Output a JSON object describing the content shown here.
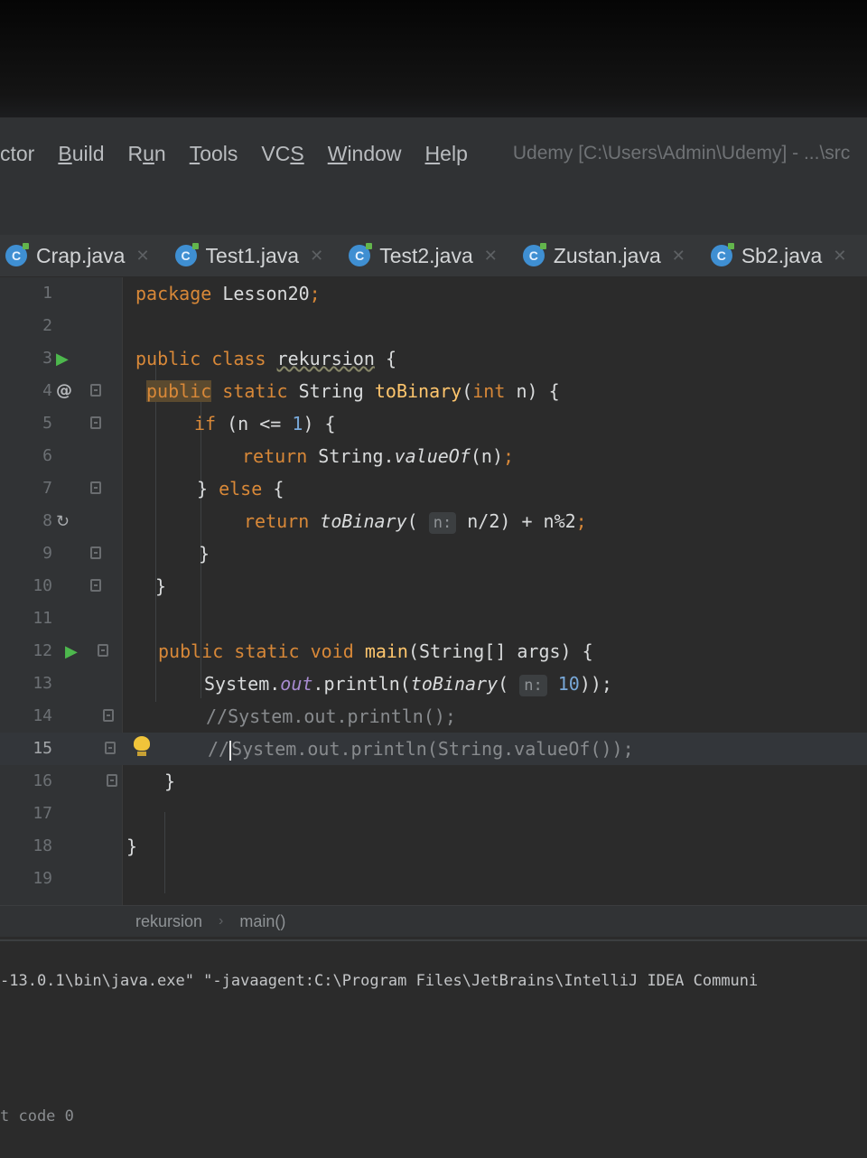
{
  "menu": {
    "items": [
      {
        "label": "ctor",
        "underline": ""
      },
      {
        "label": "Build",
        "underline": "B"
      },
      {
        "label": "Run",
        "underline": "u"
      },
      {
        "label": "Tools",
        "underline": "T"
      },
      {
        "label": "VCS",
        "underline": "S"
      },
      {
        "label": "Window",
        "underline": "W"
      },
      {
        "label": "Help",
        "underline": "H"
      }
    ],
    "window_title": "Udemy [C:\\Users\\Admin\\Udemy] - ...\\src"
  },
  "tabs": [
    {
      "label": "Crap.java",
      "icon": "java-class-icon"
    },
    {
      "label": "Test1.java",
      "icon": "java-class-icon"
    },
    {
      "label": "Test2.java",
      "icon": "java-class-icon"
    },
    {
      "label": "Zustan.java",
      "icon": "java-class-icon"
    },
    {
      "label": "Sb2.java",
      "icon": "java-class-icon"
    }
  ],
  "editor": {
    "current_line": 15,
    "lines": [
      {
        "n": "1",
        "text": "package Lesson20;"
      },
      {
        "n": "2",
        "text": ""
      },
      {
        "n": "3",
        "text": "public class rekursion {"
      },
      {
        "n": "4",
        "text": "    public static String toBinary(int n) {"
      },
      {
        "n": "5",
        "text": "        if (n <= 1) {"
      },
      {
        "n": "6",
        "text": "            return String.valueOf(n);"
      },
      {
        "n": "7",
        "text": "        } else {"
      },
      {
        "n": "8",
        "text": "            return toBinary( n: n/2) + n%2;"
      },
      {
        "n": "9",
        "text": "        }"
      },
      {
        "n": "10",
        "text": "    }"
      },
      {
        "n": "11",
        "text": ""
      },
      {
        "n": "12",
        "text": "    public static void main(String[] args) {"
      },
      {
        "n": "13",
        "text": "        System.out.println(toBinary( n: 10));"
      },
      {
        "n": "14",
        "text": "        //System.out.println();"
      },
      {
        "n": "15",
        "text": "        //System.out.println(String.valueOf());"
      },
      {
        "n": "16",
        "text": "    }"
      },
      {
        "n": "17",
        "text": ""
      },
      {
        "n": "18",
        "text": "}"
      },
      {
        "n": "19",
        "text": ""
      }
    ],
    "tokens": {
      "package": "package",
      "lesson": "Lesson20",
      "semi": ";",
      "public": "public",
      "class": "class",
      "classname": "rekursion",
      "lbrace": "{",
      "rbrace": "}",
      "static": "static",
      "string": "String",
      "tobinary": "toBinary",
      "int": "int",
      "n": "n",
      "if": "if",
      "cond": "(n <= ",
      "one": "1",
      "close_brace": ") {",
      "return": "return",
      "valueof": "valueOf",
      "valueof_args": "(n)",
      "else": "else",
      "hint_n": "n:",
      "div": "n/2",
      "rest": ") + n%2",
      "void": "void",
      "main": "main",
      "main_args": "(String[] args) {",
      "system": "System.",
      "out": "out",
      "println": ".println(",
      "ten": "10",
      "end": "));",
      "comment14": "//System.out.println();",
      "comment15a": "//",
      "comment15b": "System.out.println(String.valueOf());",
      "dot": ".",
      "lparen": "(",
      "space": " "
    }
  },
  "breadcrumb": {
    "items": [
      "rekursion",
      "main()"
    ]
  },
  "console": {
    "command": "-13.0.1\\bin\\java.exe\" \"-javaagent:C:\\Program Files\\JetBrains\\IntelliJ IDEA Communi",
    "exit": "t code 0"
  },
  "colors": {
    "keyword": "#d88838",
    "method": "#ffc66d",
    "number": "#78a8d8",
    "comment": "#888b8e",
    "field": "#a88bd0"
  }
}
